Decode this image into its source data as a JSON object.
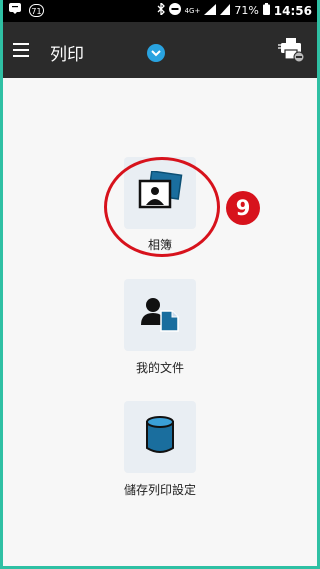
{
  "status_bar": {
    "badge": "71",
    "network": "4G+",
    "battery": "71%",
    "time": "14:56"
  },
  "app_bar": {
    "title": "列印"
  },
  "menu": {
    "items": [
      {
        "label": "相簿",
        "icon": "photo-album-icon"
      },
      {
        "label": "我的文件",
        "icon": "document-person-icon"
      },
      {
        "label": "儲存列印設定",
        "icon": "database-icon"
      }
    ]
  },
  "annotation": {
    "step": "9",
    "color": "#d7121c"
  },
  "colors": {
    "accent": "#29a3e0",
    "dark_blue": "#0b5f8c",
    "app_bar": "#2b2b2b",
    "tile_bg": "#e9eef3"
  }
}
